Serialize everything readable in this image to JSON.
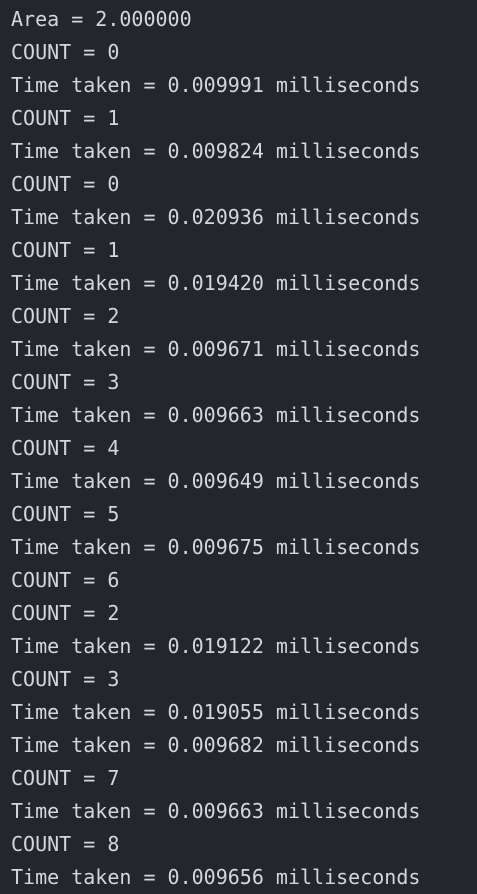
{
  "terminal": {
    "lines": [
      "Area = 2.000000",
      "COUNT = 0",
      "Time taken = 0.009991 milliseconds",
      "COUNT = 1",
      "Time taken = 0.009824 milliseconds",
      "COUNT = 0",
      "Time taken = 0.020936 milliseconds",
      "COUNT = 1",
      "Time taken = 0.019420 milliseconds",
      "COUNT = 2",
      "Time taken = 0.009671 milliseconds",
      "COUNT = 3",
      "Time taken = 0.009663 milliseconds",
      "COUNT = 4",
      "Time taken = 0.009649 milliseconds",
      "COUNT = 5",
      "Time taken = 0.009675 milliseconds",
      "COUNT = 6",
      "COUNT = 2",
      "Time taken = 0.019122 milliseconds",
      "COUNT = 3",
      "Time taken = 0.019055 milliseconds",
      "Time taken = 0.009682 milliseconds",
      "COUNT = 7",
      "Time taken = 0.009663 milliseconds",
      "COUNT = 8",
      "Time taken = 0.009656 milliseconds"
    ],
    "colors": {
      "background": "#24262e",
      "text": "#d4d6dc"
    }
  }
}
